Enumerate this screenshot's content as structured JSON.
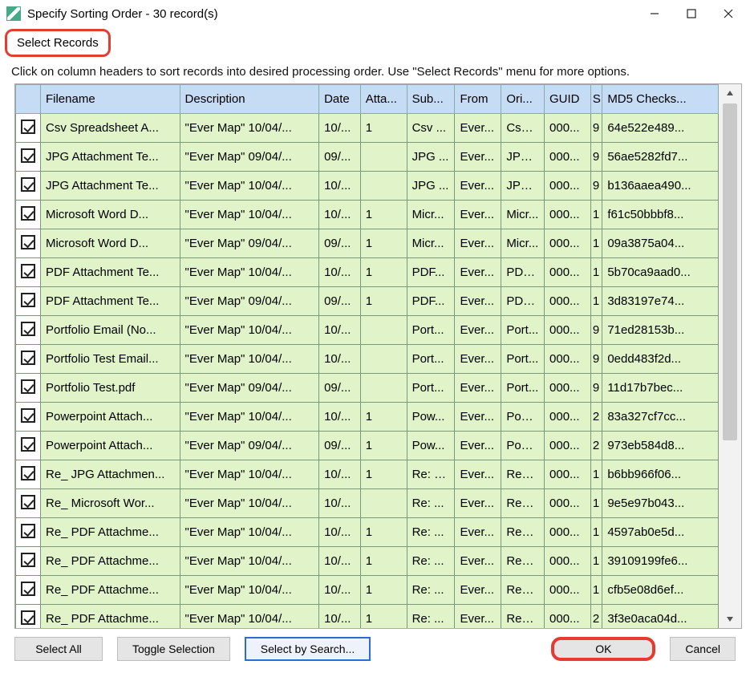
{
  "window": {
    "title": "Specify Sorting Order - 30 record(s)"
  },
  "menu": {
    "select_records": "Select Records"
  },
  "hint": "Click on column headers to sort records into desired processing order. Use \"Select Records\" menu for more options.",
  "columns": {
    "filename": "Filename",
    "description": "Description",
    "date": "Date",
    "attach": "Atta...",
    "subject": "Sub...",
    "from": "From",
    "origin": "Ori...",
    "guid": "GUID",
    "s": "S",
    "md5": "MD5 Checks..."
  },
  "rows": [
    {
      "filename": "Csv Spreadsheet A...",
      "desc": "\"Ever Map\" 10/04/...",
      "date": "10/...",
      "att": "1",
      "sub": "Csv ...",
      "from": "Ever...",
      "ori": "Csv ...",
      "guid": "000...",
      "s": "9",
      "md5": "64e522e489..."
    },
    {
      "filename": "JPG Attachment Te...",
      "desc": "\"Ever Map\" 09/04/...",
      "date": "09/...",
      "att": "",
      "sub": "JPG ...",
      "from": "Ever...",
      "ori": "JPG ...",
      "guid": "000...",
      "s": "9",
      "md5": "56ae5282fd7..."
    },
    {
      "filename": "JPG Attachment Te...",
      "desc": "\"Ever Map\" 10/04/...",
      "date": "10/...",
      "att": "",
      "sub": "JPG ...",
      "from": "Ever...",
      "ori": "JPG ...",
      "guid": "000...",
      "s": "9",
      "md5": "b136aaea490..."
    },
    {
      "filename": "Microsoft Word D...",
      "desc": "\"Ever Map\" 10/04/...",
      "date": "10/...",
      "att": "1",
      "sub": "Micr...",
      "from": "Ever...",
      "ori": "Micr...",
      "guid": "000...",
      "s": "1",
      "md5": "f61c50bbbf8..."
    },
    {
      "filename": "Microsoft Word D...",
      "desc": "\"Ever Map\" 09/04/...",
      "date": "09/...",
      "att": "1",
      "sub": "Micr...",
      "from": "Ever...",
      "ori": "Micr...",
      "guid": "000...",
      "s": "1",
      "md5": "09a3875a04..."
    },
    {
      "filename": "PDF Attachment Te...",
      "desc": "\"Ever Map\" 10/04/...",
      "date": "10/...",
      "att": "1",
      "sub": "PDF...",
      "from": "Ever...",
      "ori": "PDF...",
      "guid": "000...",
      "s": "1",
      "md5": "5b70ca9aad0..."
    },
    {
      "filename": "PDF Attachment Te...",
      "desc": "\"Ever Map\" 09/04/...",
      "date": "09/...",
      "att": "1",
      "sub": "PDF...",
      "from": "Ever...",
      "ori": "PDF...",
      "guid": "000...",
      "s": "1",
      "md5": "3d83197e74..."
    },
    {
      "filename": "Portfolio Email (No...",
      "desc": "\"Ever Map\" 10/04/...",
      "date": "10/...",
      "att": "",
      "sub": "Port...",
      "from": "Ever...",
      "ori": "Port...",
      "guid": "000...",
      "s": "9",
      "md5": "71ed28153b..."
    },
    {
      "filename": "Portfolio Test Email...",
      "desc": "\"Ever Map\" 10/04/...",
      "date": "10/...",
      "att": "",
      "sub": "Port...",
      "from": "Ever...",
      "ori": "Port...",
      "guid": "000...",
      "s": "9",
      "md5": "0edd483f2d..."
    },
    {
      "filename": "Portfolio Test.pdf",
      "desc": "\"Ever Map\" 09/04/...",
      "date": "09/...",
      "att": "",
      "sub": "Port...",
      "from": "Ever...",
      "ori": "Port...",
      "guid": "000...",
      "s": "9",
      "md5": "11d17b7bec..."
    },
    {
      "filename": "Powerpoint Attach...",
      "desc": "\"Ever Map\" 10/04/...",
      "date": "10/...",
      "att": "1",
      "sub": "Pow...",
      "from": "Ever...",
      "ori": "Pow...",
      "guid": "000...",
      "s": "2",
      "md5": "83a327cf7cc..."
    },
    {
      "filename": "Powerpoint Attach...",
      "desc": "\"Ever Map\" 09/04/...",
      "date": "09/...",
      "att": "1",
      "sub": "Pow...",
      "from": "Ever...",
      "ori": "Pow...",
      "guid": "000...",
      "s": "2",
      "md5": "973eb584d8..."
    },
    {
      "filename": "Re_ JPG Attachmen...",
      "desc": "\"Ever Map\" 10/04/...",
      "date": "10/...",
      "att": "1",
      "sub": "Re: J...",
      "from": "Ever...",
      "ori": "Re_ ...",
      "guid": "000...",
      "s": "1",
      "md5": "b6bb966f06..."
    },
    {
      "filename": "Re_ Microsoft Wor...",
      "desc": "\"Ever Map\" 10/04/...",
      "date": "10/...",
      "att": "",
      "sub": "Re: ...",
      "from": "Ever...",
      "ori": "Re_ ...",
      "guid": "000...",
      "s": "1",
      "md5": "9e5e97b043..."
    },
    {
      "filename": "Re_ PDF Attachme...",
      "desc": "\"Ever Map\" 10/04/...",
      "date": "10/...",
      "att": "1",
      "sub": "Re: ...",
      "from": "Ever...",
      "ori": "Re_ ...",
      "guid": "000...",
      "s": "1",
      "md5": "4597ab0e5d..."
    },
    {
      "filename": "Re_ PDF Attachme...",
      "desc": "\"Ever Map\" 10/04/...",
      "date": "10/...",
      "att": "1",
      "sub": "Re: ...",
      "from": "Ever...",
      "ori": "Re_ ...",
      "guid": "000...",
      "s": "1",
      "md5": "39109199fe6..."
    },
    {
      "filename": "Re_ PDF Attachme...",
      "desc": "\"Ever Map\" 10/04/...",
      "date": "10/...",
      "att": "1",
      "sub": "Re: ...",
      "from": "Ever...",
      "ori": "Re_ ...",
      "guid": "000...",
      "s": "1",
      "md5": "cfb5e08d6ef..."
    },
    {
      "filename": "Re_ PDF Attachme...",
      "desc": "\"Ever Map\" 10/04/...",
      "date": "10/...",
      "att": "1",
      "sub": "Re: ...",
      "from": "Ever...",
      "ori": "Re_ ...",
      "guid": "000...",
      "s": "2",
      "md5": "3f3e0aca04d..."
    }
  ],
  "buttons": {
    "select_all": "Select All",
    "toggle": "Toggle Selection",
    "search": "Select by Search...",
    "ok": "OK",
    "cancel": "Cancel"
  }
}
